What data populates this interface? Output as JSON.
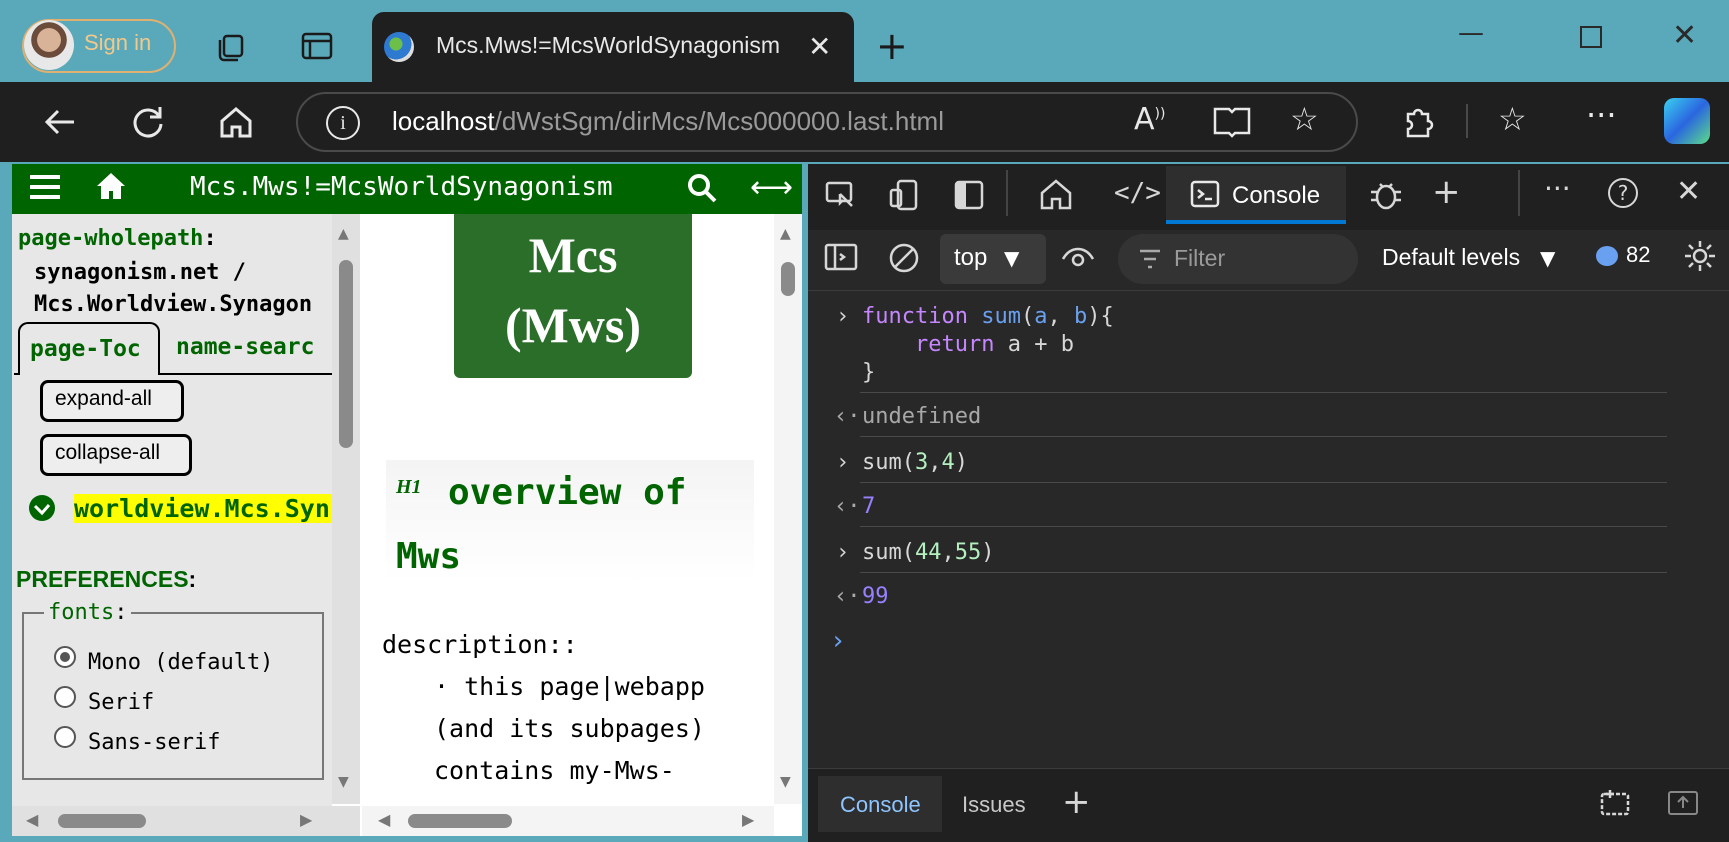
{
  "browser": {
    "signin_label": "Sign in",
    "tab_title": "Mcs.Mws!=McsWorldSynagonism",
    "url_host": "localhost",
    "url_path": "/dWstSgm/dirMcs/Mcs000000.last.html"
  },
  "page": {
    "header_title": "Mcs.Mws!=McsWorldSynagonism",
    "wholepath_label": "page-wholepath",
    "wholepath_line1": "synagonism.net /",
    "wholepath_line2": "Mcs.Worldview.Synagon",
    "tabs": [
      "page-Toc",
      "name-searc"
    ],
    "expand_all": "expand-all",
    "collapse_all": "collapse-all",
    "toc_item": "worldview.Mcs.Syn",
    "preferences_label": "PREFERENCES",
    "fonts_legend": "fonts",
    "font_options": [
      "Mono (default)",
      "Serif",
      "Sans-serif"
    ],
    "logo_line1": "Mcs",
    "logo_line2": "(Mws)",
    "h1_marker": "H1",
    "h1_line1": "overview of",
    "h1_line2": "Mws",
    "description_label": "description::",
    "desc_lines": [
      "· this page|webapp",
      "(and its subpages)",
      "contains my-Mws-"
    ]
  },
  "devtools": {
    "console_tab": "Console",
    "context": "top",
    "filter_placeholder": "Filter",
    "levels": "Default levels",
    "message_count": "82",
    "console_lines": [
      {
        "type": "input",
        "text": "function sum(a, b){"
      },
      {
        "type": "cont",
        "text": "    return a + b"
      },
      {
        "type": "cont",
        "text": "}"
      },
      {
        "type": "output",
        "text": "undefined"
      },
      {
        "type": "input",
        "text": "sum(3,4)"
      },
      {
        "type": "output",
        "text": "7"
      },
      {
        "type": "input",
        "text": "sum(44,55)"
      },
      {
        "type": "output",
        "text": "99"
      }
    ],
    "drawer_tabs": [
      "Console",
      "Issues"
    ]
  },
  "colors": {
    "accent_green": "#006400",
    "highlight_yellow": "#ffff00",
    "console_keyword": "#c586ff",
    "console_number": "#9980ff",
    "tab_underline": "#0078d4"
  }
}
